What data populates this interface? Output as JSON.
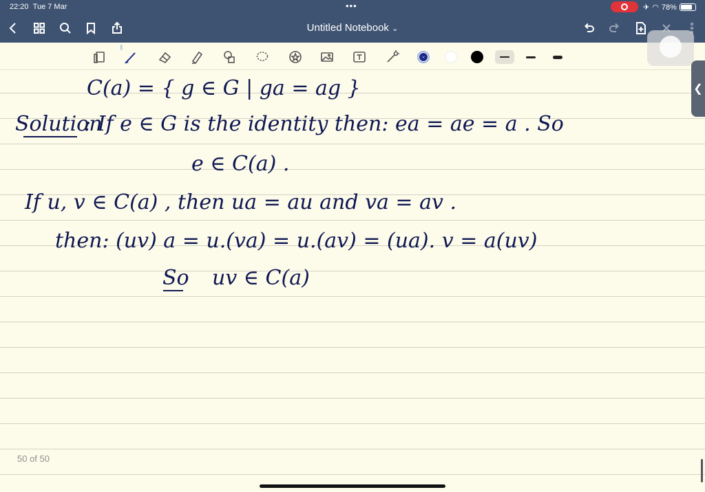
{
  "status_bar": {
    "time": "22:20",
    "date": "Tue 7 Mar",
    "battery": "78%"
  },
  "navbar": {
    "title": "Untitled Notebook",
    "title_chevron": "⌄"
  },
  "toolbar": {
    "tools": [
      "pages-icon",
      "pen-icon",
      "eraser-icon",
      "highlighter-icon",
      "shapes-icon",
      "lasso-icon",
      "sticker-icon",
      "image-icon",
      "text-icon",
      "laser-icon"
    ],
    "colors": [
      "#1c2b8a",
      "#ffffff",
      "#000000"
    ],
    "selected_color": "#1c2b8a"
  },
  "notes": {
    "line1": "C(a) = { g ∈ G |  ga = ag }",
    "line2_label": "Solution",
    "line2": ":   If  e ∈ G  is  the identity  then:  ea = ae = a . So",
    "line3": "e ∈ C(a) .",
    "line4": "If  u, v ∈ C(a) ,  then    ua = au    and    va = av .",
    "line5": "then:  (uv) a  =  u.(va)  =  u.(av)  =  (ua). v  =  a(uv)",
    "line6_label": "So",
    "line6": "uv ∈ C(a)"
  },
  "page_counter": "50 of 50",
  "colors": {
    "header": "#3e5372",
    "paper": "#fdfbea",
    "ink": "#0e1752"
  }
}
